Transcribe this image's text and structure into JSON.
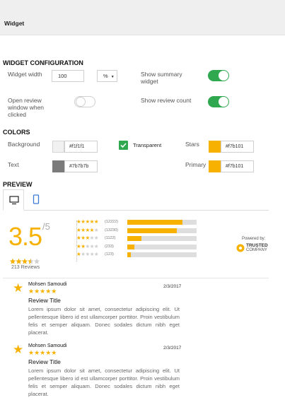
{
  "header": {
    "title": "Widget"
  },
  "config": {
    "heading": "WIDGET CONFIGURATION",
    "width_label": "Widget width",
    "width_value": "100",
    "width_unit": "%",
    "open_window_label": "Open review window when clicked",
    "open_window_on": false,
    "show_summary_label": "Show summary widget",
    "show_summary_on": true,
    "show_count_label": "Show review count",
    "show_count_on": true
  },
  "colors": {
    "heading": "COLORS",
    "background_label": "Background",
    "background_value": "#f1f1f1",
    "background_swatch": "#f1f1f1",
    "transparent_label": "Transparent",
    "transparent_checked": true,
    "stars_label": "Stars",
    "stars_value": "#f7b101",
    "stars_swatch": "#f7b101",
    "text_label": "Text",
    "text_value": "#7b7b7b",
    "text_swatch": "#7b7b7b",
    "primary_label": "Primary",
    "primary_value": "#f7b101",
    "primary_swatch": "#f7b101"
  },
  "preview": {
    "heading": "PREVIEW",
    "tabs": [
      "desktop-icon",
      "mobile-icon"
    ],
    "score": "3.5",
    "score_max": "/5",
    "reviews_count": "213 Reviews",
    "rating_stars": 3.5,
    "distribution": [
      {
        "stars": 5,
        "count": "(12222)",
        "fill": 0.8
      },
      {
        "stars": 4,
        "count": "(13230)",
        "fill": 0.71
      },
      {
        "stars": 3,
        "count": "(1122)",
        "fill": 0.2
      },
      {
        "stars": 2,
        "count": "(233)",
        "fill": 0.1
      },
      {
        "stars": 1,
        "count": "(123)",
        "fill": 0.05
      }
    ],
    "powered_by": "Powered by:",
    "brand_line1": "TRUSTED",
    "brand_line2": "COMPANY",
    "reviews": [
      {
        "name": "Mohsen Samoudi",
        "date": "2/3/2017",
        "stars": 5,
        "title": "Review Title",
        "body": "Lorem ipsum dolor sit amet, consectetur adipiscing elit. Ut pellentesque libero id est ullamcorper porttitor. Proin vestibulum felis et semper aliquam. Donec sodales dictum nibh eget placerat."
      },
      {
        "name": "Mohsen Samoudi",
        "date": "2/3/2017",
        "stars": 5,
        "title": "Review Title",
        "body": "Lorem ipsum dolor sit amet, consectetur adipiscing elit. Ut pellentesque libero id est ullamcorper porttitor. Proin vestibulum felis et semper aliquam. Donec sodales dictum nibh eget placerat."
      }
    ]
  }
}
